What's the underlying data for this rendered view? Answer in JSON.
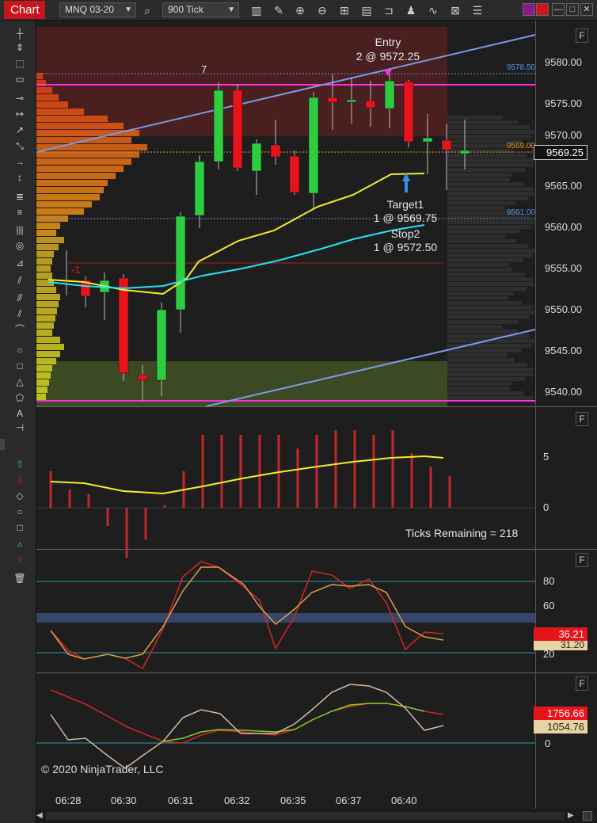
{
  "toolbar": {
    "app_title": "Chart",
    "instrument": "MNQ 03-20",
    "interval": "900 Tick",
    "icons": [
      "search-icon",
      "bar-type-icon",
      "pencil-icon",
      "zoom-in-icon",
      "zoom-out-icon",
      "crosshair-icon",
      "properties-icon",
      "template-icon",
      "strategy-icon",
      "indicator-icon",
      "data-box-icon"
    ],
    "window_buttons": [
      "color-swatch",
      "close-accent",
      "minimize",
      "maximize",
      "close"
    ]
  },
  "leftbar": {
    "tools": [
      "trend-line-icon",
      "cursor-icon",
      "select-rect-icon",
      "range-icon",
      "horizontal-line-icon",
      "ray-icon",
      "extended-line-icon",
      "arrow-line-icon",
      "vertical-line-icon",
      "fibonacci-icon",
      "fib-extension-icon",
      "gann-fan-icon",
      "regression-icon",
      "andrews-icon",
      "parallel-icon",
      "arc-icon",
      "ellipse-icon",
      "rectangle-icon",
      "polygon-icon",
      "triangle-icon",
      "text-icon",
      "ruler-icon",
      "arrow-up-icon",
      "arrow-down-icon",
      "diamond-icon",
      "dot-icon",
      "square-icon",
      "triangle-up-icon",
      "triangle-down-icon",
      "trash-icon"
    ]
  },
  "price_panel": {
    "price_labels": [
      "9580.00",
      "9575.00",
      "9570.00",
      "9565.00",
      "9560.00",
      "9555.00",
      "9550.00",
      "9545.00",
      "9540.00"
    ],
    "current_price": "9569.25",
    "marker_labels": {
      "upper": "9578.50",
      "mid": "9569.00",
      "lower": "9561.00"
    },
    "bar_count_label": "7",
    "signal_label": "-1",
    "entry_title": "Entry",
    "entry_detail": "2 @ 9572.25",
    "target_title": "Target1",
    "target_detail": "1 @ 9569.75",
    "stop_title": "Stop2",
    "stop_detail": "1 @ 9572.50",
    "colors": {
      "up": "#2ecc40",
      "down": "#e8141b",
      "magenta": "#ff2ddc",
      "sma_yellow": "#f2ee2b",
      "sma_cyan": "#25e3f2",
      "channel": "#7a9ae8"
    }
  },
  "volume_panel": {
    "labels": [
      "5",
      "0"
    ],
    "ticks_remaining": "Ticks Remaining = 218"
  },
  "stoch_panel": {
    "labels": [
      "80",
      "60",
      "20"
    ],
    "current_value": "36.21",
    "secondary_value": "31.20"
  },
  "osc_panel": {
    "labels": [
      "0"
    ],
    "value_1": "1756.66",
    "value_2": "1054.76"
  },
  "time_axis": [
    "06:28",
    "06:30",
    "06:31",
    "06:32",
    "06:35",
    "06:37",
    "06:40"
  ],
  "panel_button": "F",
  "copyright": "© 2020 NinjaTrader, LLC"
}
